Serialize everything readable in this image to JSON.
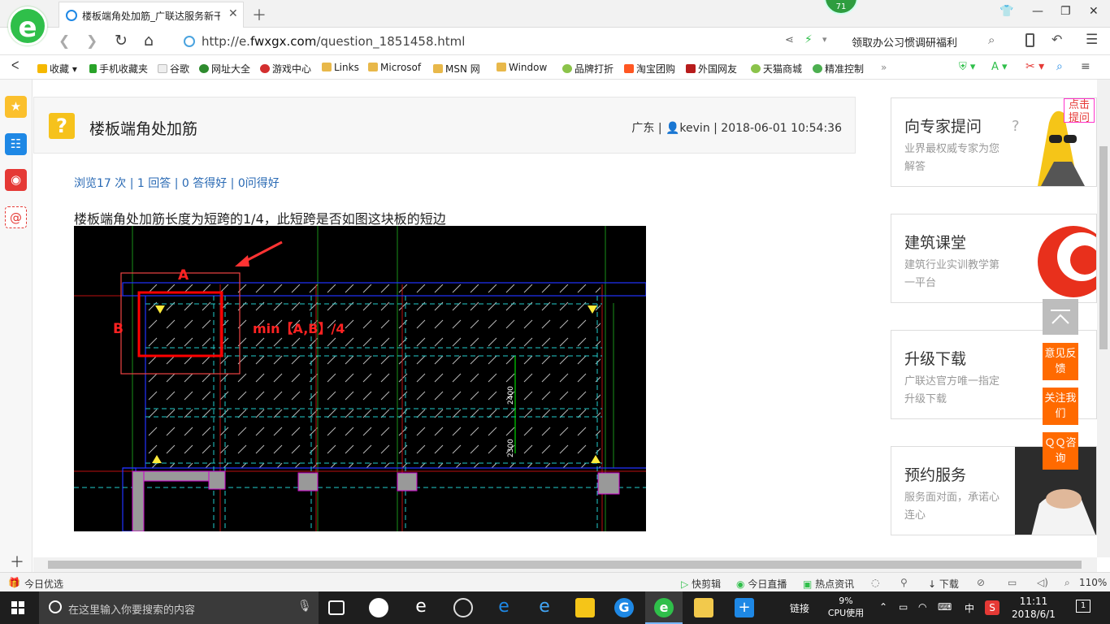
{
  "browser": {
    "tab_title": "楼板端角处加筋_广联达服务新干",
    "badge": "71",
    "url_prefix": "http://e.",
    "url_domain": "fwxgx.com",
    "url_path": "/question_1851458.html",
    "promo": "领取办公习惯调研福利"
  },
  "bookmarks": [
    {
      "label": "收藏",
      "color": "#f5b800"
    },
    {
      "label": "手机收藏夹",
      "color": "#29a329"
    },
    {
      "label": "谷歌",
      "color": "#bbbbbb"
    },
    {
      "label": "网址大全",
      "color": "#2e8b2e"
    },
    {
      "label": "游戏中心",
      "color": "#d32f2f"
    },
    {
      "label": "Links",
      "color": "#e8b84a"
    },
    {
      "label": "Microsof",
      "color": "#e8b84a"
    },
    {
      "label": "MSN 网",
      "color": "#e8b84a"
    },
    {
      "label": "Window",
      "color": "#e8b84a"
    },
    {
      "label": "品牌打折",
      "color": "#8bc34a"
    },
    {
      "label": "淘宝团购",
      "color": "#ff5722"
    },
    {
      "label": "外国网友",
      "color": "#b71c1c"
    },
    {
      "label": "天猫商城",
      "color": "#8bc34a"
    },
    {
      "label": "精准控制",
      "color": "#4caf50"
    }
  ],
  "question": {
    "title": "楼板端角处加筋",
    "meta": "广东 | 👤kevin | 2018-06-01 10:54:36",
    "stats": "浏览17 次 | 1 回答 | 0 答得好 | 0问得好",
    "text": "楼板端角处加筋长度为短跨的1/4，此短跨是否如图这块板的短边"
  },
  "cad": {
    "label_a": "A",
    "label_b": "B",
    "formula": "min【A,B】/4",
    "dim1": "2400",
    "dim2": "2300"
  },
  "ads": [
    {
      "title": "向专家提问",
      "sub": "业界最权威专家为您解答"
    },
    {
      "title": "建筑课堂",
      "sub": "建筑行业实训教学第一平台"
    },
    {
      "title": "升级下载",
      "sub": "广联达官方唯一指定升级下载"
    },
    {
      "title": "预约服务",
      "sub": "服务面对面，承诺心连心"
    }
  ],
  "corner_tag": "点击提问",
  "float_buttons": [
    "意见反馈",
    "关注我们",
    "ＱＱ咨询"
  ],
  "statusbar": {
    "left": "今日优选",
    "items": [
      "快剪辑",
      "今日直播",
      "热点资讯",
      "下载"
    ],
    "zoom": "110%"
  },
  "taskbar": {
    "search_placeholder": "在这里输入你要搜索的内容",
    "link": "链接",
    "cpu_pct": "9%",
    "cpu_label": "CPU使用",
    "ime": "中",
    "time": "11:11",
    "date": "2018/6/1",
    "notif": "1"
  }
}
